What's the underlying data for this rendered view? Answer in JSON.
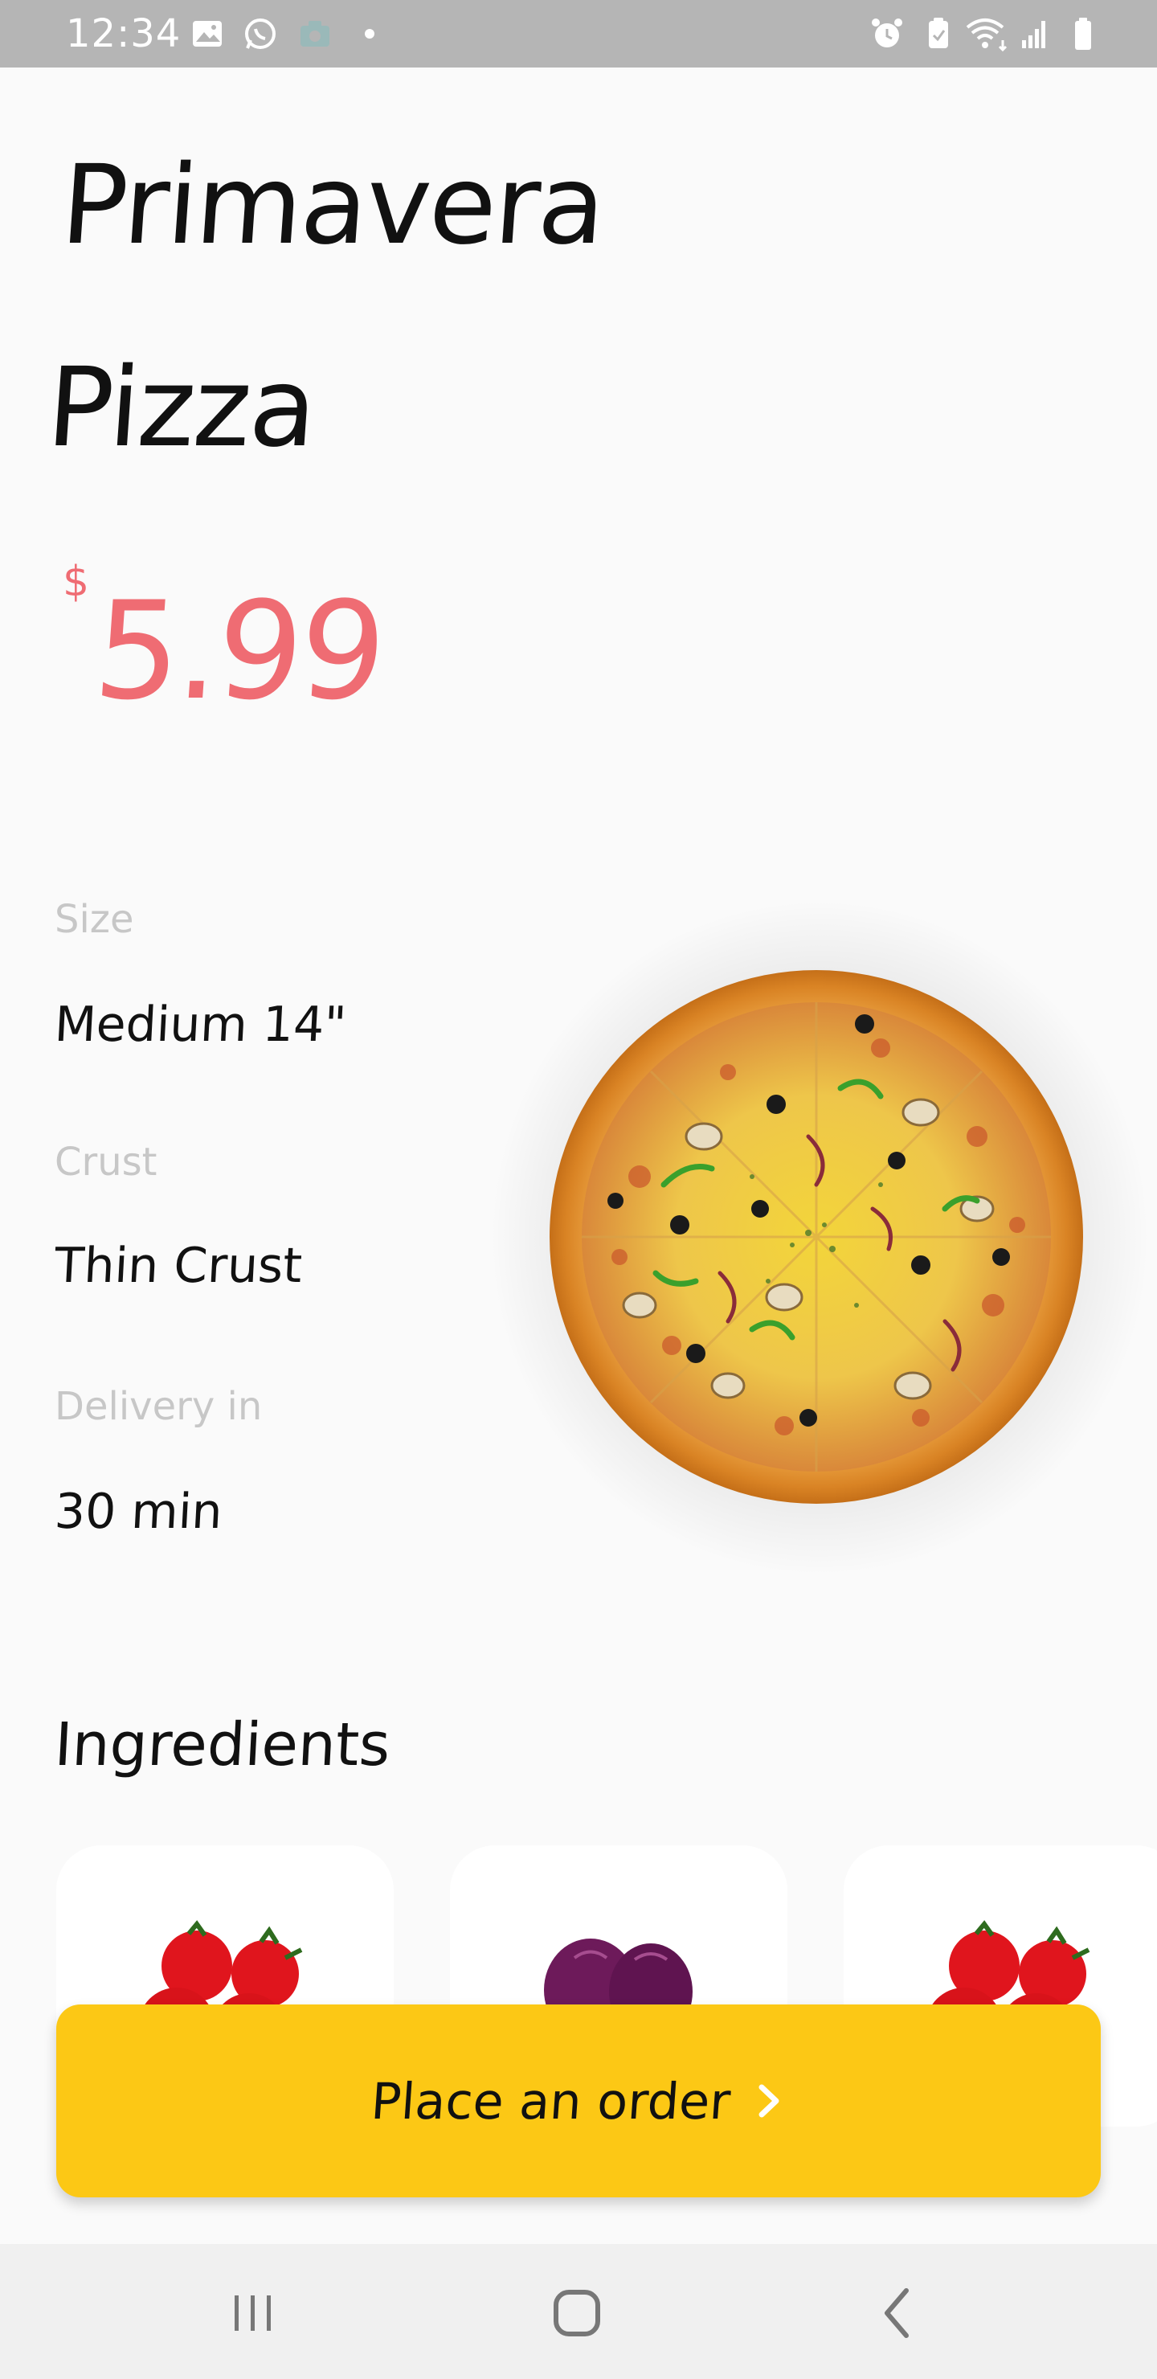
{
  "status_bar": {
    "time": "12:34",
    "left_icons": [
      "gallery-icon",
      "whatsapp-icon",
      "camera-icon",
      "dot-icon"
    ],
    "right_icons": [
      "alarm-icon",
      "battery-saver-icon",
      "wifi-icon",
      "signal-icon",
      "battery-icon"
    ]
  },
  "product": {
    "title_line1": "Primavera",
    "title_line2": "Pizza",
    "currency": "$",
    "price": "5.99"
  },
  "details": [
    {
      "label": "Size",
      "value": "Medium 14\""
    },
    {
      "label": "Crust",
      "value": "Thin Crust"
    },
    {
      "label": "Delivery in",
      "value": "30 min"
    }
  ],
  "ingredients": {
    "title": "Ingredients",
    "items": [
      "tomato-icon",
      "onion-icon",
      "tomato-icon"
    ]
  },
  "order_button": {
    "label": "Place an order"
  },
  "nav_bar": {
    "buttons": [
      "recent-apps-icon",
      "home-icon",
      "back-icon"
    ]
  },
  "colors": {
    "accent_price": "#ef6c73",
    "button_yellow": "#fcc815",
    "label_gray": "#c7c7c7",
    "status_bar": "#b5b5b5"
  }
}
